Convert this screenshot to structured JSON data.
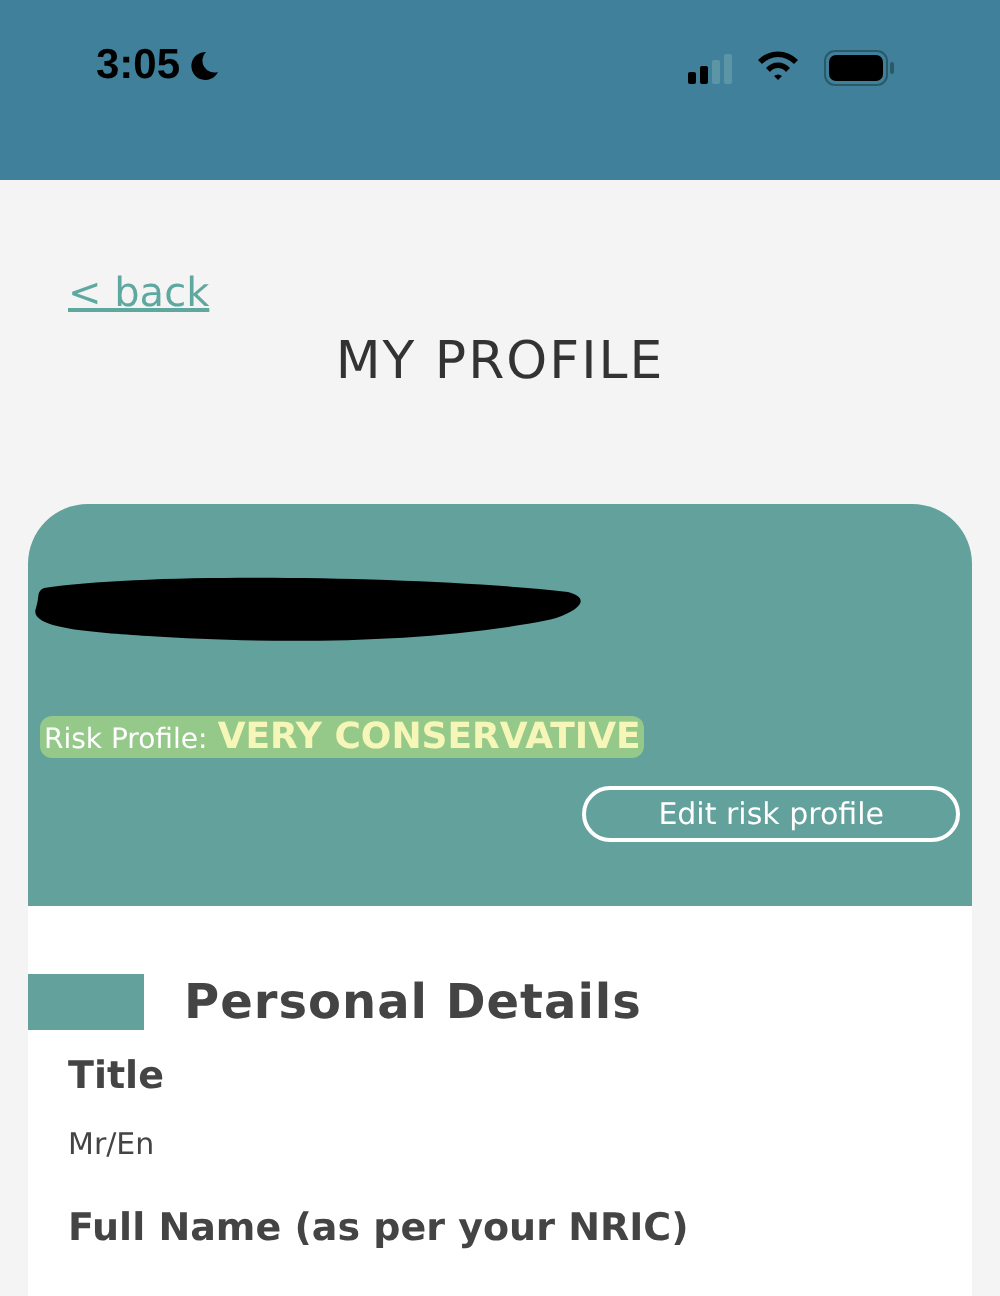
{
  "status_bar": {
    "time": "3:05"
  },
  "header": {
    "back": "< back",
    "title": "MY PROFILE"
  },
  "profile_card": {
    "risk_label": "Risk Profile:",
    "risk_value": "VERY CONSERVATIVE",
    "edit_button": "Edit risk profile"
  },
  "section": {
    "title": "Personal Details",
    "fields": [
      {
        "label": "Title",
        "value": "Mr/En"
      },
      {
        "label": "Full Name (as per your NRIC)"
      }
    ]
  }
}
